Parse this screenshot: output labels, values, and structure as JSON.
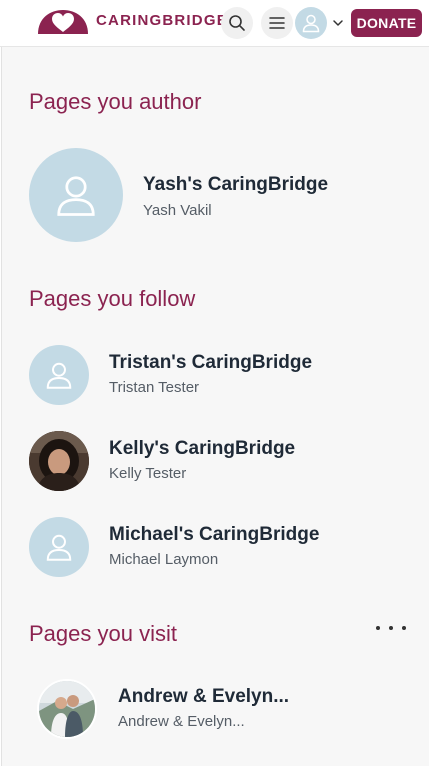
{
  "header": {
    "logo_text": "CARINGBRIDGE",
    "donate_label": "DONATE",
    "icons": {
      "search": "search-icon",
      "menu": "menu-icon",
      "avatar": "user-icon",
      "dropdown": "chevron-down-icon"
    }
  },
  "sections": {
    "author": {
      "title": "Pages you author",
      "items": [
        {
          "title": "Yash's CaringBridge",
          "subtitle": "Yash Vakil",
          "avatar": "user-icon"
        }
      ]
    },
    "follow": {
      "title": "Pages you follow",
      "items": [
        {
          "title": "Tristan's CaringBridge",
          "subtitle": "Tristan Tester",
          "avatar": "user-icon"
        },
        {
          "title": "Kelly's CaringBridge",
          "subtitle": "Kelly Tester",
          "avatar": "photo"
        },
        {
          "title": "Michael's CaringBridge",
          "subtitle": "Michael Laymon",
          "avatar": "user-icon"
        }
      ]
    },
    "visit": {
      "title": "Pages you visit",
      "more_icon": "more-horizontal-icon",
      "items": [
        {
          "title": "Andrew & Evelyn...",
          "subtitle": "Andrew & Evelyn...",
          "avatar": "photo"
        }
      ]
    }
  },
  "colors": {
    "brand": "#8b2350",
    "avatar_bg": "#c3dae5",
    "content_bg": "#f7f7f7",
    "text_dark": "#1f2a37"
  }
}
